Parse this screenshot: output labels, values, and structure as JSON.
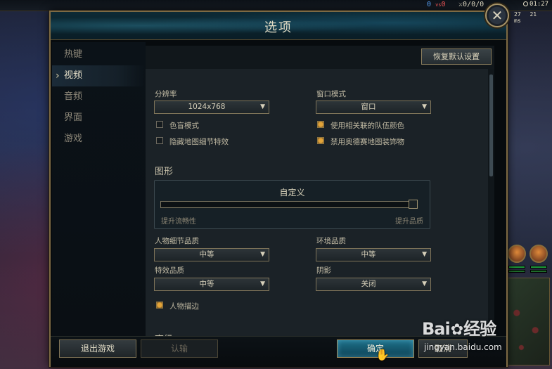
{
  "hud": {
    "score_blue": "0",
    "score_vs": "vs",
    "score_red": "0",
    "kda": "0/0/0",
    "time": "01:27",
    "cs": "27",
    "ping": "21 ms"
  },
  "dialog": {
    "title": "选项",
    "close_icon": "✕"
  },
  "sidebar": {
    "items": [
      {
        "label": "热键"
      },
      {
        "label": "视频"
      },
      {
        "label": "音频"
      },
      {
        "label": "界面"
      },
      {
        "label": "游戏"
      }
    ],
    "active_index": 1
  },
  "panel": {
    "restore_defaults_label": "恢复默认设置",
    "resolution": {
      "label": "分辨率",
      "value": "1024x768"
    },
    "window_mode": {
      "label": "窗口模式",
      "value": "窗口"
    },
    "checkboxes_left": [
      {
        "label": "色盲模式",
        "checked": false
      },
      {
        "label": "隐藏地图细节特效",
        "checked": false
      }
    ],
    "checkboxes_right": [
      {
        "label": "使用相关联的队伍颜色",
        "checked": true
      },
      {
        "label": "禁用奥德赛地图装饰物",
        "checked": true
      }
    ],
    "graphics": {
      "section_title": "图形",
      "preset": "自定义",
      "left_hint": "提升流畅性",
      "right_hint": "提升品质",
      "level": 1.0
    },
    "character_quality": {
      "label": "人物细节品质",
      "value": "中等"
    },
    "environment_quality": {
      "label": "环境品质",
      "value": "中等"
    },
    "effects_quality": {
      "label": "特效品质",
      "value": "中等"
    },
    "shadows": {
      "label": "阴影",
      "value": "关闭"
    },
    "outline": {
      "label": "人物描边",
      "checked": true
    },
    "advanced_title": "高级"
  },
  "footer": {
    "exit_label": "退出游戏",
    "surrender_label": "认输",
    "confirm_label": "确定",
    "cancel_label": "取消"
  },
  "watermark": {
    "logo_left": "Bai",
    "logo_right": "经验",
    "url": "jingyan.baidu.com"
  },
  "colors": {
    "accent_gold": "#7d6a44",
    "confirm_teal": "#1d6f88",
    "checkbox_orange": "#e2a43a"
  }
}
